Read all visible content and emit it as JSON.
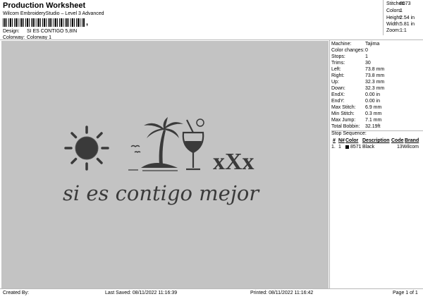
{
  "header": {
    "title": "Production Worksheet",
    "subtitle": "Wilcom EmbroideryStudio – Level 3 Advanced",
    "barcode_suffix": ","
  },
  "meta": {
    "design_label": "Design:",
    "design_value": "SI ES CONTIGO 5,8IN",
    "colorway_label": "Colorway:",
    "colorway_value": "Colorway 1"
  },
  "stats": [
    {
      "label": "Stitches:",
      "value": "8573"
    },
    {
      "label": "Colors:",
      "value": "1"
    },
    {
      "label": "Height:",
      "value": "2.54 in"
    },
    {
      "label": "Width:",
      "value": "5.81 in"
    },
    {
      "label": "Zoom:",
      "value": "1:1"
    }
  ],
  "details": [
    {
      "label": "Machine:",
      "value": "Tajima"
    },
    {
      "label": "Color changes:",
      "value": "0"
    },
    {
      "label": "Stops:",
      "value": "1"
    },
    {
      "label": "Trims:",
      "value": "30"
    },
    {
      "label": "Left:",
      "value": "73.8 mm"
    },
    {
      "label": "Right:",
      "value": "73.8 mm"
    },
    {
      "label": "Up:",
      "value": "32.3 mm"
    },
    {
      "label": "Down:",
      "value": "32.3 mm"
    },
    {
      "label": "EndX:",
      "value": "0.00 in"
    },
    {
      "label": "EndY:",
      "value": "0.00 in"
    },
    {
      "label": "Max Stitch:",
      "value": "6.9 mm"
    },
    {
      "label": "Min Stitch:",
      "value": "0.3 mm"
    },
    {
      "label": "Max Jump:",
      "value": "7.1 mm"
    },
    {
      "label": "Total Bobbin:",
      "value": "32.19ft"
    }
  ],
  "stop_sequence": {
    "title": "Stop Sequence:",
    "headers": [
      "#",
      "N#",
      "Color",
      "Description",
      "Code",
      "Brand"
    ],
    "rows": [
      {
        "num": "1.",
        "n": "1",
        "color": "8571",
        "color_hex": "#000000",
        "description": "Black",
        "code": "13",
        "brand": "Wilcom"
      }
    ]
  },
  "design": {
    "script_text": "si es contigo mejor",
    "xxx_text": "xXx",
    "background": "#c3c3c3",
    "thread_color": "#3a3a3a"
  },
  "footer": {
    "created_by": "Created By:",
    "last_saved": "Last Saved: 08/11/2022 11:16:39",
    "printed": "Printed: 08/11/2022 11:16:42",
    "page": "Page 1 of 1"
  }
}
